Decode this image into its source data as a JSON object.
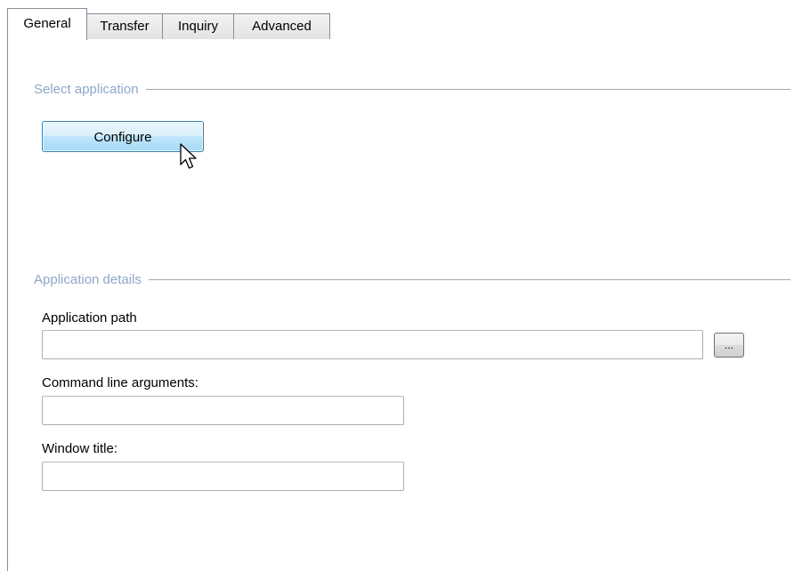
{
  "tabs": {
    "general": "General",
    "transfer": "Transfer",
    "inquiry": "Inquiry",
    "advanced": "Advanced",
    "active": "General"
  },
  "select_application": {
    "header": "Select application",
    "configure_label": "Configure"
  },
  "application_details": {
    "header": "Application details",
    "app_path_label": "Application path",
    "app_path_value": "",
    "browse_label": "...",
    "cmd_args_label": "Command line arguments:",
    "cmd_args_value": "",
    "window_title_label": "Window title:",
    "window_title_value": ""
  },
  "icons": {
    "cursor": "mouse-pointer-icon"
  },
  "colors": {
    "group_header_text": "#8ea7c9",
    "button_border": "#3c7fb1",
    "button_fill_top": "#eaf6fd",
    "button_fill_bottom": "#a7d9f5",
    "tab_border": "#898c95"
  }
}
